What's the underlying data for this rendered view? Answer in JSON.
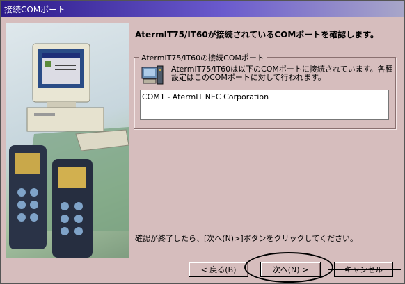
{
  "window": {
    "title": "接続COMポート"
  },
  "heading": "AtermIT75/IT60が接続されているCOMポートを確認します。",
  "group": {
    "label": "AtermIT75/IT60の接続COMポート",
    "info_line1": "AtermIT75/IT60は以下のCOMポートに接続されています。各種",
    "info_line2": "設定はこのCOMポートに対して行われます。",
    "icon": "computer-icon"
  },
  "com_list": {
    "selected": "COM1 - AtermIT NEC Corporation"
  },
  "instruction": "確認が終了したら、[次へ(N)>]ボタンをクリックしてください。",
  "buttons": {
    "back": "< 戻る(B)",
    "next": "次へ(N) >",
    "cancel": "キャンセル"
  }
}
